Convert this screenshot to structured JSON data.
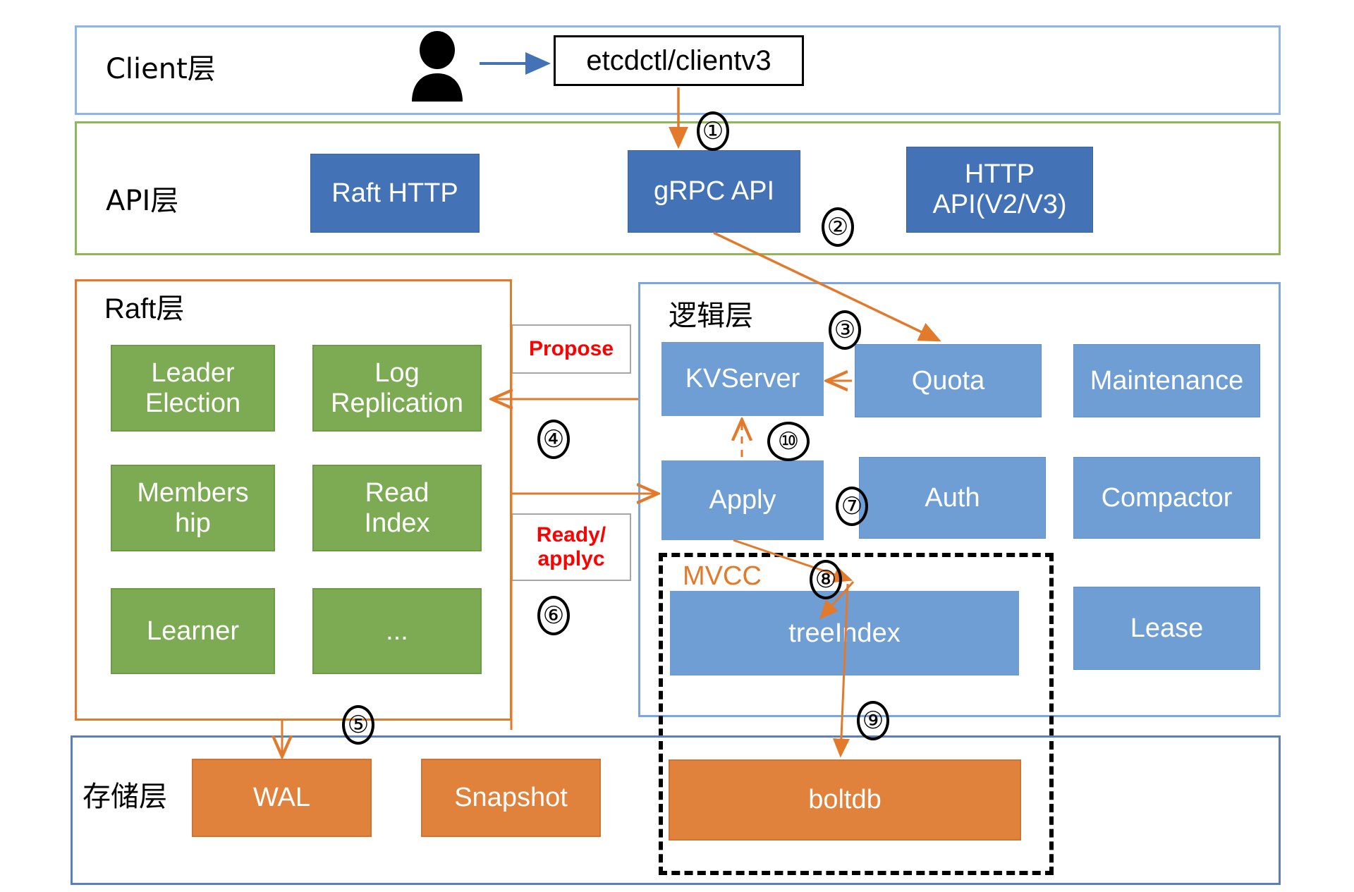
{
  "diagram": {
    "title": "etcd architecture layers",
    "colors": {
      "client_border": "#8eb4e3",
      "api_border": "#8fb75a",
      "raft_border": "#e2792b",
      "logic_border": "#7aa6dd",
      "storage_border": "#5b7fbe",
      "api_node": "#4472b6",
      "raft_node": "#7cab54",
      "logic_node": "#6e9ed4",
      "storage_node": "#e0813c",
      "arrow": "#e2792b",
      "client_arrow": "#4472b6",
      "label_text": "#ff0000",
      "mvcc_text": "#e2792b"
    },
    "layers": [
      {
        "id": "client",
        "title": "Client层"
      },
      {
        "id": "api",
        "title": "API层"
      },
      {
        "id": "raft",
        "title": "Raft层"
      },
      {
        "id": "logic",
        "title": "逻辑层"
      },
      {
        "id": "storage",
        "title": "存储层"
      }
    ],
    "client": {
      "actor_icon": "user-icon",
      "client_box": "etcdctl/clientv3"
    },
    "api": {
      "nodes": [
        {
          "id": "raft-http",
          "label": "Raft HTTP"
        },
        {
          "id": "grpc-api",
          "label": "gRPC API"
        },
        {
          "id": "http-api",
          "label": "HTTP\nAPI(V2/V3)"
        }
      ]
    },
    "raft": {
      "nodes": [
        {
          "id": "leader-election",
          "label": "Leader\nElection"
        },
        {
          "id": "log-replication",
          "label": "Log\nReplication"
        },
        {
          "id": "membership",
          "label": "Members\nhip"
        },
        {
          "id": "read-index",
          "label": "Read\nIndex"
        },
        {
          "id": "learner",
          "label": "Learner"
        },
        {
          "id": "more",
          "label": "..."
        }
      ]
    },
    "logic": {
      "nodes": [
        {
          "id": "kvserver",
          "label": "KVServer"
        },
        {
          "id": "quota",
          "label": "Quota"
        },
        {
          "id": "maintenance",
          "label": "Maintenance"
        },
        {
          "id": "apply",
          "label": "Apply"
        },
        {
          "id": "auth",
          "label": "Auth"
        },
        {
          "id": "compactor",
          "label": "Compactor"
        },
        {
          "id": "treeindex",
          "label": "treeIndex"
        },
        {
          "id": "lease",
          "label": "Lease"
        }
      ],
      "mvcc_label": "MVCC"
    },
    "storage": {
      "nodes": [
        {
          "id": "wal",
          "label": "WAL"
        },
        {
          "id": "snapshot",
          "label": "Snapshot"
        },
        {
          "id": "boltdb",
          "label": "boltdb"
        }
      ]
    },
    "edge_labels": [
      {
        "id": "propose",
        "label": "Propose"
      },
      {
        "id": "ready",
        "label": "Ready/\napplyc"
      }
    ],
    "steps": [
      {
        "id": "step-1",
        "label": "①"
      },
      {
        "id": "step-2",
        "label": "②"
      },
      {
        "id": "step-3",
        "label": "③"
      },
      {
        "id": "step-4",
        "label": "④"
      },
      {
        "id": "step-5",
        "label": "⑤"
      },
      {
        "id": "step-6",
        "label": "⑥"
      },
      {
        "id": "step-7",
        "label": "⑦"
      },
      {
        "id": "step-8",
        "label": "⑧"
      },
      {
        "id": "step-9",
        "label": "⑨"
      },
      {
        "id": "step-10",
        "label": "⑩"
      }
    ]
  }
}
